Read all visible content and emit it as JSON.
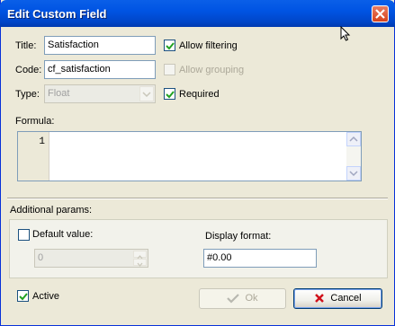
{
  "window": {
    "title": "Edit Custom Field"
  },
  "fields": {
    "title_label": "Title:",
    "title_value": "Satisfaction",
    "code_label": "Code:",
    "code_value": "cf_satisfaction",
    "type_label": "Type:",
    "type_value": "Float"
  },
  "options": {
    "allow_filtering": {
      "label": "Allow filtering",
      "checked": true,
      "enabled": true
    },
    "allow_grouping": {
      "label": "Allow grouping",
      "checked": false,
      "enabled": false
    },
    "required": {
      "label": "Required",
      "checked": true,
      "enabled": true
    }
  },
  "formula": {
    "label": "Formula:",
    "line_numbers": [
      "1"
    ],
    "text": ""
  },
  "additional": {
    "label": "Additional params:",
    "default_value_label": "Default value:",
    "default_value_checked": false,
    "default_value": "0",
    "display_format_label": "Display format:",
    "display_format_value": "#0.00"
  },
  "footer": {
    "active_label": "Active",
    "active_checked": true,
    "ok_label": "Ok",
    "cancel_label": "Cancel"
  },
  "colors": {
    "title_bar": "#0054E3",
    "dialog_bg": "#ECE9D8",
    "check_green": "#21A121",
    "cancel_red": "#D0111B"
  }
}
